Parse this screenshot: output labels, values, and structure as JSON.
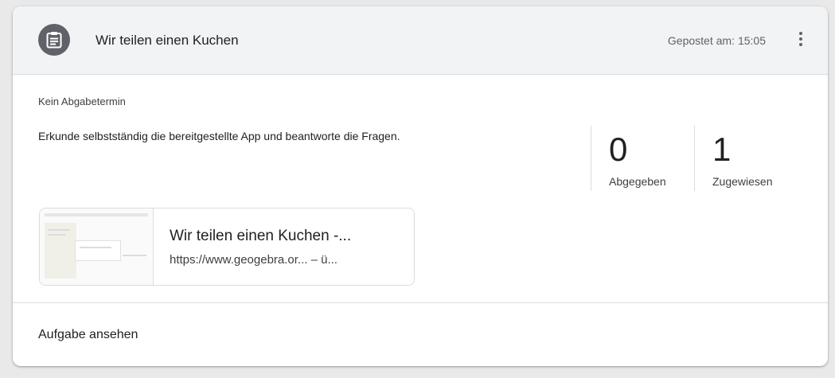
{
  "header": {
    "title": "Wir teilen einen Kuchen",
    "posted_label": "Gepostet am:",
    "posted_time": "15:05"
  },
  "icons": {
    "assignment": "assignment-icon",
    "more": "more-vert-icon"
  },
  "body": {
    "due": "Kein Abgabetermin",
    "description": "Erkunde selbstständig die bereitgestellte App und beantworte die Fragen."
  },
  "stats": [
    {
      "value": "0",
      "label": "Abgegeben"
    },
    {
      "value": "1",
      "label": "Zugewiesen"
    }
  ],
  "attachment": {
    "title": "Wir teilen einen Kuchen -...",
    "url": "https://www.geogebra.or... – ü..."
  },
  "footer": {
    "view_label": "Aufgabe ansehen"
  },
  "colors": {
    "header_bg": "#f1f3f4",
    "icon_bg": "#5f6368",
    "divider": "#dadce0"
  }
}
